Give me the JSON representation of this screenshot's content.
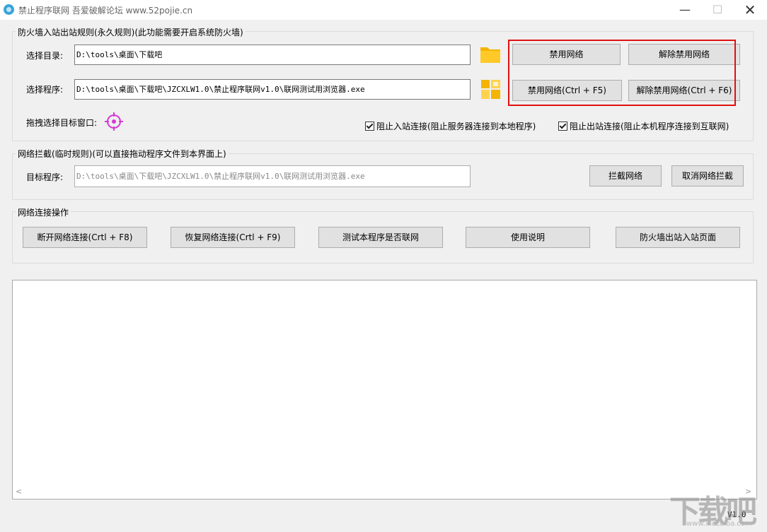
{
  "window": {
    "title": "禁止程序联网 吾爱破解论坛 www.52pojie.cn",
    "minimize": "—",
    "maximize": "☐",
    "close": "✕"
  },
  "firewall_group": {
    "label": "防火墙入站出站规则(永久规则)(此功能需要开启系统防火墙)",
    "dir_label": "选择目录:",
    "dir_value": "D:\\tools\\桌面\\下载吧",
    "prog_label": "选择程序:",
    "prog_value": "D:\\tools\\桌面\\下载吧\\JZCXLW1.0\\禁止程序联网v1.0\\联网测试用浏览器.exe",
    "btn_block": "禁用网络",
    "btn_unblock": "解除禁用网络",
    "btn_block_hotkey": "禁用网络(Ctrl + F5)",
    "btn_unblock_hotkey": "解除禁用网络(Ctrl + F6)",
    "drag_label": "拖拽选择目标窗口:",
    "chk_inbound": "阻止入站连接(阻止服务器连接到本地程序)",
    "chk_outbound": "阻止出站连接(阻止本机程序连接到互联网)",
    "icons": {
      "folder": "folder-icon",
      "program": "program-grid-icon",
      "target": "crosshair-target-icon"
    },
    "highlight_color": "#e01010"
  },
  "intercept_group": {
    "label": "网络拦截(临时规则)(可以直接拖动程序文件到本界面上)",
    "target_label": "目标程序:",
    "target_value": "D:\\tools\\桌面\\下载吧\\JZCXLW1.0\\禁止程序联网v1.0\\联网测试用浏览器.exe",
    "btn_intercept": "拦截网络",
    "btn_cancel": "取消网络拦截"
  },
  "ops_group": {
    "label": "网络连接操作",
    "btn_disconnect": "断开网络连接(Crtl + F8)",
    "btn_restore": "恢复网络连接(Crtl + F9)",
    "btn_test": "测试本程序是否联网",
    "btn_help": "使用说明",
    "btn_fw_page": "防火墙出站入站页面"
  },
  "log": {
    "scroll_left": "<",
    "scroll_right": ">",
    "version": "V1.0"
  },
  "watermark": {
    "text": "下载吧",
    "url": "www.xiazaiba.com"
  }
}
